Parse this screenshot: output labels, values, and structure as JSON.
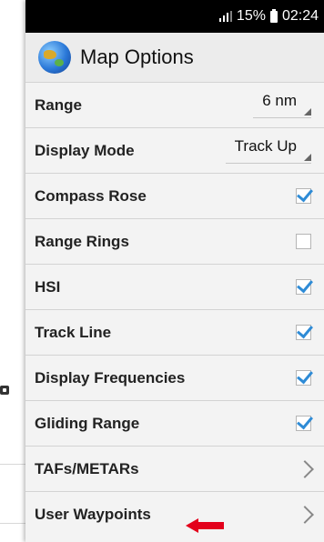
{
  "status_bar": {
    "battery": "15%",
    "time": "02:24"
  },
  "header": {
    "title": "Map Options"
  },
  "options": [
    {
      "label": "Range",
      "value": "6 nm"
    },
    {
      "label": "Display Mode",
      "value": "Track Up"
    },
    {
      "label": "Compass Rose",
      "checked": true
    },
    {
      "label": "Range Rings",
      "checked": false
    },
    {
      "label": "HSI",
      "checked": true
    },
    {
      "label": "Track Line",
      "checked": true
    },
    {
      "label": "Display Frequencies",
      "checked": true
    },
    {
      "label": "Gliding Range",
      "checked": true
    },
    {
      "label": "TAFs/METARs"
    },
    {
      "label": "User Waypoints"
    }
  ],
  "colors": {
    "accent": "#2e8bd6",
    "annotation_arrow": "#e3001b"
  },
  "icons": {
    "app": "globe-icon",
    "annotation": "red-arrow-icon"
  }
}
